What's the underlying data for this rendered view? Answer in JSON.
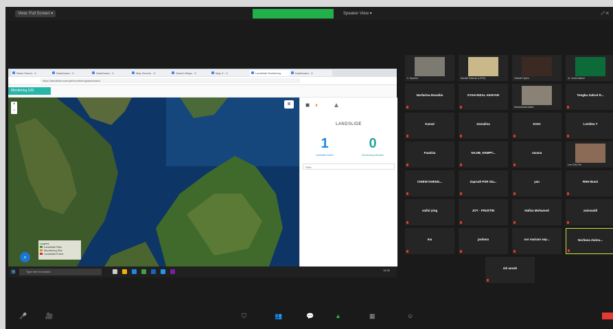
{
  "topbar": {
    "view_label": "View: Full Screen ▾",
    "rec_label": "● Recording",
    "speaker_label": "Speaker View ▾",
    "right_label": "⤢ ✕"
  },
  "browser": {
    "tabs": [
      "News Sound - X",
      "Dashboard - X",
      "Dashboard - X",
      "Map Service - X",
      "Search Ways - X",
      "Map X - X",
      "Landslide Monitoring",
      "Dashboard - X"
    ],
    "url": "https://landslide.example/monitoring/dashboard"
  },
  "app": {
    "title": "Monitoring GIS",
    "zoom_in": "+",
    "zoom_out": "−",
    "layers_icon": "layers-icon",
    "legend_title": "Legend",
    "legend_items": [
      {
        "label": "Landslide Risk",
        "color": "#2ca02c"
      },
      {
        "label": "Monitoring Site",
        "color": "#ff7f0e"
      },
      {
        "label": "Landslide Event",
        "color": "#d62728"
      }
    ],
    "panel_title": "LANDSLIDE",
    "stat1_value": "1",
    "stat1_label": "Landslide Active",
    "stat2_value": "0",
    "stat2_label": "Monitoring Activated",
    "filter_label": "Filter"
  },
  "taskbar": {
    "search_placeholder": "Type here to search",
    "clock": "14:32"
  },
  "gallery": [
    {
      "name": "",
      "caption": "Ir. Syahrul",
      "video": true,
      "color": "#7d7a72"
    },
    {
      "name": "",
      "caption": "Nuraini Hasnah (UiTM)",
      "video": true,
      "color": "#c9b98a"
    },
    {
      "name": "",
      "caption": "Gabriel Hydra",
      "video": true,
      "color": "#3b2a22"
    },
    {
      "name": "",
      "caption": "dr. mohd hakimi",
      "video": true,
      "color": "#0d6b3a"
    },
    {
      "name": "Norfarina Rosslim",
      "caption": "",
      "video": false
    },
    {
      "name": "SYAH RIZAL AKHYAR",
      "caption": "",
      "video": false
    },
    {
      "name": "",
      "caption": "Muhammad Adam",
      "video": true,
      "color": "#8a8275"
    },
    {
      "name": "Tengku Zahrul R...",
      "caption": "",
      "video": false
    },
    {
      "name": "Kamal",
      "caption": "",
      "video": false
    },
    {
      "name": "Zamalina",
      "caption": "",
      "video": false
    },
    {
      "name": "DAKI",
      "caption": "",
      "video": false
    },
    {
      "name": "Loeldea T",
      "caption": "",
      "video": false
    },
    {
      "name": "Faudzia",
      "caption": "",
      "video": false
    },
    {
      "name": "NAJIB_KEMPT...",
      "caption": "",
      "video": false
    },
    {
      "name": "ravana",
      "caption": "",
      "video": false
    },
    {
      "name": "",
      "caption": "Lee Chin Fei",
      "video": true,
      "color": "#8b6b55"
    },
    {
      "name": "CHIEW KHENG...",
      "caption": "",
      "video": false
    },
    {
      "name": "Zaprudi PSR Sta...",
      "caption": "",
      "video": false
    },
    {
      "name": "yan",
      "caption": "",
      "video": false
    },
    {
      "name": "RHH Bumi",
      "caption": "",
      "video": false
    },
    {
      "name": "saiful ying",
      "caption": "",
      "video": false
    },
    {
      "name": "JOY - FRUSTIN",
      "caption": "",
      "video": false
    },
    {
      "name": "Hafiza Mohamed",
      "caption": "",
      "video": false
    },
    {
      "name": "zaimsaidi",
      "caption": "",
      "video": false
    },
    {
      "name": "Ina",
      "caption": "",
      "video": false
    },
    {
      "name": "jardana",
      "caption": "",
      "video": false
    },
    {
      "name": "nor mariam sep...",
      "caption": "",
      "video": false
    },
    {
      "name": "Norliana Zaimu...",
      "caption": "",
      "video": false
    },
    {
      "name": "siti aesah",
      "caption": "",
      "video": false
    }
  ],
  "bottombar": {
    "mute": "🎤",
    "video": "🎥",
    "security": "⛉",
    "participants": "👥",
    "chat": "💬",
    "share": "▲",
    "record": "⏺",
    "breakout": "▦",
    "reactions": "☺"
  }
}
